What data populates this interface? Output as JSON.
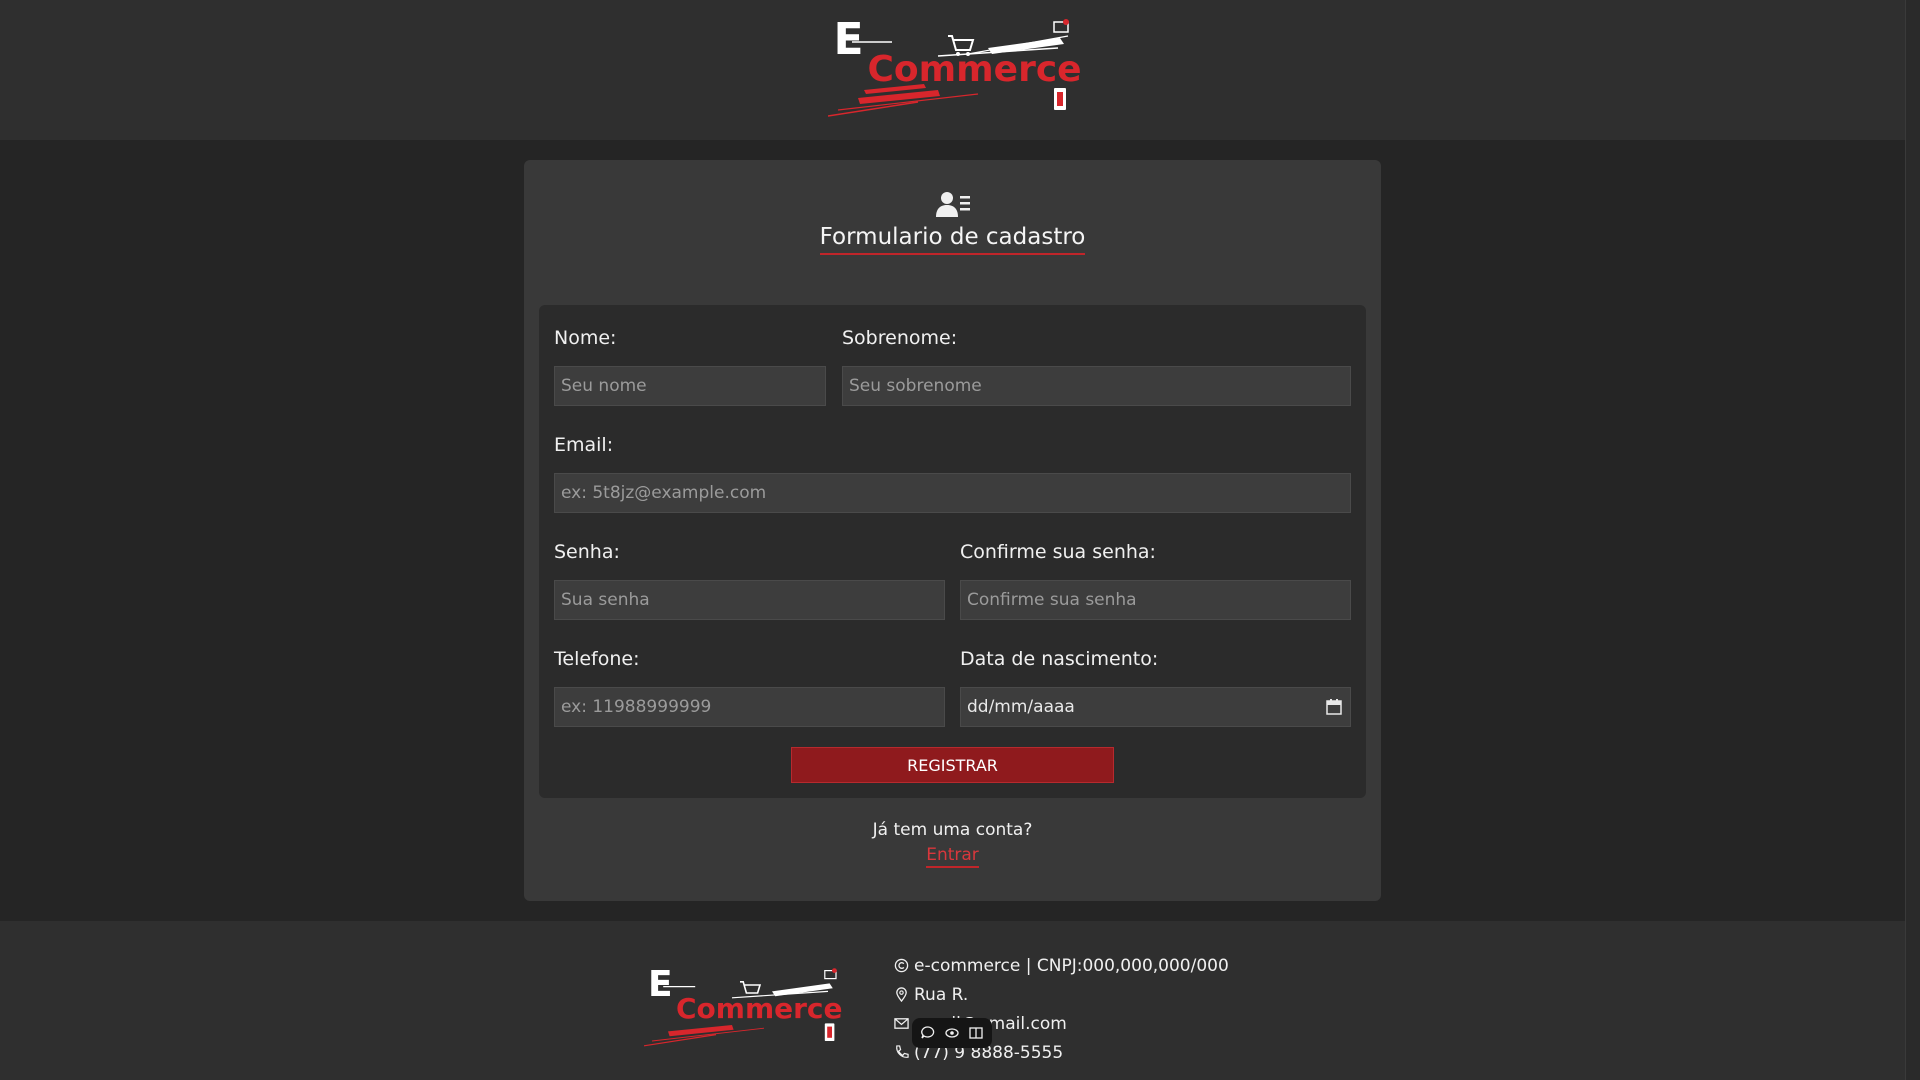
{
  "brand": {
    "letter": "E",
    "word": "Commerce",
    "colors": {
      "accent": "#d8262c",
      "button": "#8f1a1d",
      "background": "#252525",
      "panel": "#393939"
    }
  },
  "form": {
    "icon": "user-list-icon",
    "title": "Formulario de cadastro",
    "fields": {
      "nome": {
        "label": "Nome:",
        "placeholder": "Seu nome"
      },
      "sobrenome": {
        "label": "Sobrenome:",
        "placeholder": "Seu sobrenome"
      },
      "email": {
        "label": "Email:",
        "placeholder": "ex: 5t8jz@example.com"
      },
      "senha": {
        "label": "Senha:",
        "placeholder": "Sua senha"
      },
      "confirma": {
        "label": "Confirme sua senha:",
        "placeholder": "Confirme sua senha"
      },
      "telefone": {
        "label": "Telefone:",
        "placeholder": "ex: 11988999999"
      },
      "nascimento": {
        "label": "Data de nascimento:",
        "value": "dd/mm/aaaa"
      }
    },
    "submit_label": "REGISTRAR",
    "have_account": "Já tem uma conta?",
    "login_link": "Entrar"
  },
  "footer": {
    "copyright": "e-commerce | CNPJ:000,000,000/000",
    "address": "Rua R.",
    "email": "email@gmail.com",
    "phone": "(77) 9 8888-5555"
  }
}
